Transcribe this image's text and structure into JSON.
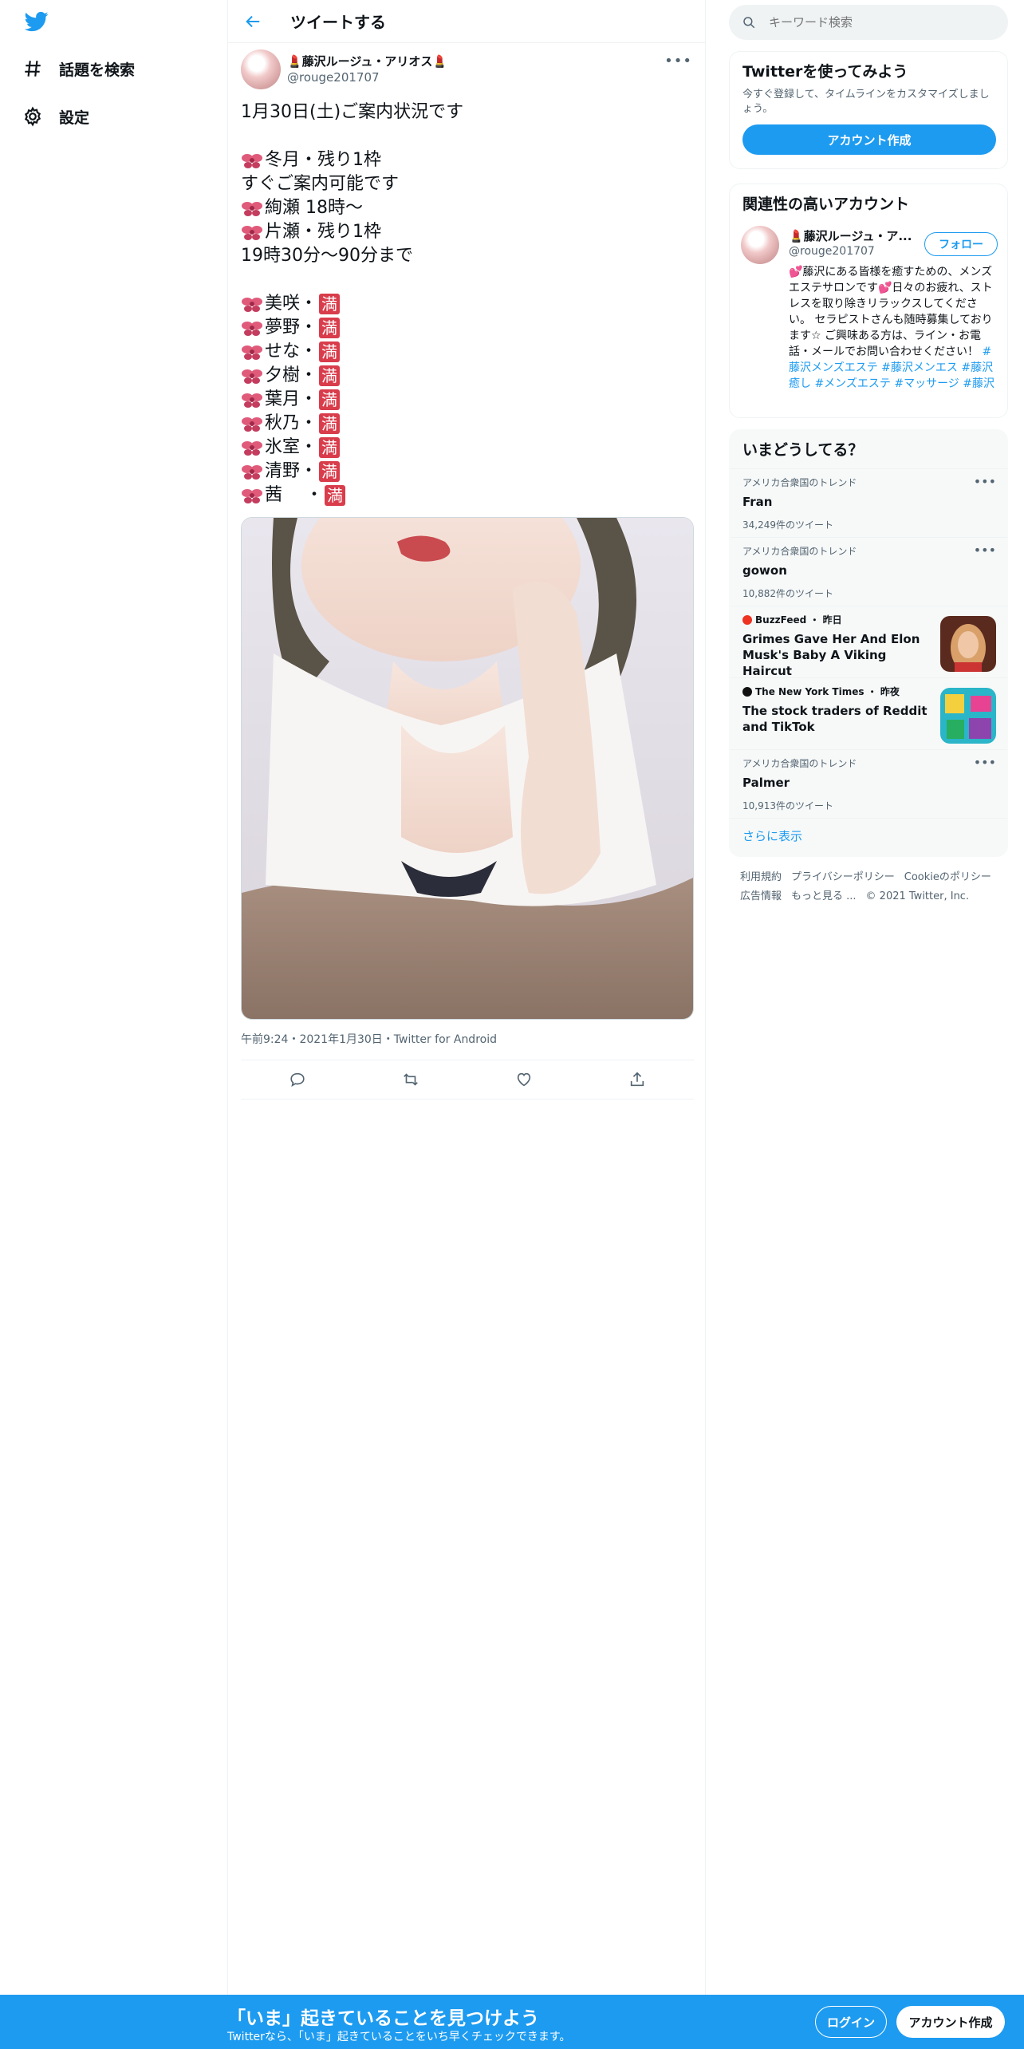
{
  "nav": {
    "logo_icon": "twitter-bird-icon",
    "items": [
      {
        "icon": "hashtag-icon",
        "label": "話題を検索"
      },
      {
        "icon": "gear-icon",
        "label": "設定"
      }
    ]
  },
  "main": {
    "title": "ツイートする",
    "author": {
      "name": "💄藤沢ルージュ・アリオス💄",
      "handle": "@rouge201707"
    },
    "tweet": {
      "heading": "1月30日(土)ご案内状況です",
      "lines": [
        {
          "bow": true,
          "text": "冬月・残り1枠"
        },
        {
          "bow": false,
          "text": "すぐご案内可能です"
        },
        {
          "bow": true,
          "text": "絢瀬 18時～"
        },
        {
          "bow": true,
          "text": "片瀬・残り1枠"
        },
        {
          "bow": false,
          "text": "19時30分～90分まで"
        }
      ],
      "full_label": "満",
      "staff": [
        "美咲・",
        "夢野・",
        "せな・",
        "夕樹・",
        "葉月・",
        "秋乃・",
        "氷室・",
        "清野・",
        "茜　 ・"
      ]
    },
    "meta": "午前9:24・2021年1月30日・Twitter for Android"
  },
  "right": {
    "search": {
      "placeholder": "キーワード検索"
    },
    "signup": {
      "title": "Twitterを使ってみよう",
      "subtitle": "今すぐ登録して、タイムラインをカスタマイズしましょう。",
      "button": "アカウント作成"
    },
    "related": {
      "title": "関連性の高いアカウント",
      "name": "💄藤沢ルージュ・ア...",
      "handle": "@rouge201707",
      "follow": "フォロー",
      "bio": "💕藤沢にある皆様を癒すための、メンズエステサロンです💕日々のお疲れ、ストレスを取り除きリラックスしてください。 セラピストさんも随時募集しております☆ ご興味ある方は、ライン・お電話・メールでお問い合わせください！",
      "tags": "#藤沢メンズエステ #藤沢メンエス #藤沢癒し #メンズエステ #マッサージ #藤沢"
    },
    "trends": {
      "title": "いまどうしてる？",
      "items": [
        {
          "context": "アメリカ合衆国のトレンド",
          "title": "Fran",
          "count": "34,249件のツイート"
        },
        {
          "context": "アメリカ合衆国のトレンド",
          "title": "gowon",
          "count": "10,882件のツイート"
        },
        {
          "context": "BuzzFeed ・ 昨日",
          "title": "Grimes Gave Her And Elon Musk's Baby A Viking Haircut"
        },
        {
          "context": "The New York Times ・ 昨夜",
          "title": "The stock traders of Reddit and TikTok"
        },
        {
          "context": "アメリカ合衆国のトレンド",
          "title": "Palmer",
          "count": "10,913件のツイート"
        }
      ],
      "show_more": "さらに表示"
    },
    "footer": {
      "links": [
        "利用規約",
        "プライバシーポリシー",
        "Cookieのポリシー",
        "広告情報",
        "もっと見る ...",
        "© 2021 Twitter, Inc."
      ]
    }
  },
  "bottom": {
    "title": "「いま」起きていることを見つけよう",
    "subtitle": "Twitterなら、「いま」起きていることをいち早くチェックできます。",
    "login": "ログイン",
    "signup": "アカウント作成"
  },
  "colors": {
    "accent": "#1d9bf0",
    "full_badge": "#d93c4b"
  }
}
